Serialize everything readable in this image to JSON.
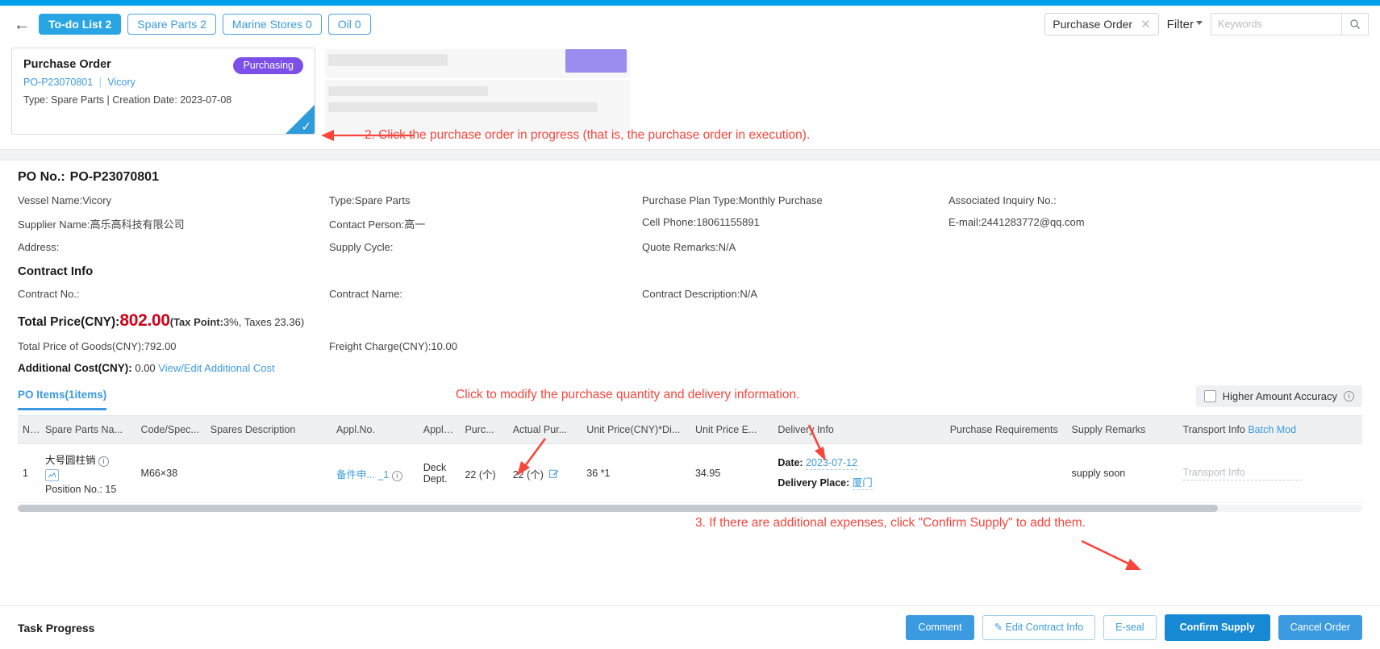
{
  "header": {
    "back_icon": "back-arrow-icon",
    "tabs": [
      {
        "label": "To-do List 2",
        "active": true
      },
      {
        "label": "Spare Parts 2",
        "active": false
      },
      {
        "label": "Marine Stores 0",
        "active": false
      },
      {
        "label": "Oil 0",
        "active": false
      }
    ],
    "type_chip": "Purchase Order",
    "clear_icon": "close-icon",
    "filter_label": "Filter",
    "search_placeholder": "Keywords",
    "search_value": "",
    "search_icon": "search-icon"
  },
  "card": {
    "title": "Purchase Order",
    "status_badge": "Purchasing",
    "po_no": "PO-P23070801",
    "separator": "|",
    "vessel": "Vicory",
    "meta": "Type:  Spare Parts | Creation Date:  2023-07-08",
    "selected_check": "check-icon"
  },
  "annotations": {
    "step2": "2. Click the purchase order in progress (that is, the purchase order in execution).",
    "modify_hint": "Click to modify the purchase quantity and delivery information.",
    "step3": "3. If there are additional expenses, click \"Confirm Supply\" to add them."
  },
  "detail": {
    "po_no_label": "PO No.:",
    "po_no_value": "PO-P23070801",
    "fields": [
      "Vessel Name:Vicory",
      "Type:Spare Parts",
      "Purchase Plan Type:Monthly Purchase",
      "Associated Inquiry No.:",
      "Supplier Name:高乐高科技有限公司",
      "Contact Person:高一",
      "Cell Phone:18061155891",
      "E-mail:2441283772@qq.com",
      "Address:",
      "Supply Cycle:",
      "Quote Remarks:N/A",
      ""
    ],
    "contract_title": "Contract Info",
    "contract_fields": [
      "Contract No.:",
      "Contract Name:",
      "Contract Description:N/A",
      ""
    ],
    "total_label": "Total Price(CNY):",
    "total_value": "802.00",
    "tax_prefix": "(Tax Point:",
    "tax_point": "3%",
    "tax_suffix": ", Taxes 23.36)",
    "total_goods": "Total Price of Goods(CNY):792.00",
    "freight": "Freight Charge(CNY):10.00",
    "addl_label": "Additional Cost(CNY):",
    "addl_value": "0.00",
    "addl_link": "View/Edit Additional Cost"
  },
  "items": {
    "tab_label": "PO Items(1items)",
    "accuracy_label": "Higher Amount Accuracy",
    "accuracy_info_icon": "info-icon",
    "accuracy_checked": false,
    "columns": [
      "N...",
      "Spare Parts Na...",
      "Code/Spec...",
      "Spares Description",
      "Appl.No.",
      "Appl. ...",
      "Purc...",
      "Actual Pur...",
      "Unit Price(CNY)*Di...",
      "Unit Price E...",
      "Delivery Info",
      "Purchase Requirements",
      "Supply Remarks",
      "Transport Info"
    ],
    "transport_batch_link": "Batch Mod",
    "rows": [
      {
        "no": "1",
        "spare_name": "大号圆柱销",
        "name_info_icon": "info-icon",
        "image_icon": "image-icon",
        "position_label": "Position No.:",
        "position_value": "15",
        "code_spec": "M66×38",
        "spares_description": "",
        "appl_no": "备件申... _1",
        "appl_no_info_icon": "info-icon",
        "appl_dept": "Deck Dept.",
        "purc_qty": "22 (个)",
        "actual_purc_qty": "22 (个)",
        "actual_edit_icon": "edit-icon",
        "unit_price_disc": "36 *1",
        "unit_price_excl": "34.95",
        "delivery_date_label": "Date:",
        "delivery_date_value": "2023-07-12",
        "delivery_place_label": "Delivery Place:",
        "delivery_place_value": "厦门",
        "purchase_requirements": "",
        "supply_remarks": "supply soon",
        "transport_placeholder": "Transport Info"
      }
    ]
  },
  "footer": {
    "task_progress": "Task Progress",
    "buttons": [
      {
        "label": "Comment",
        "style": "blue"
      },
      {
        "label": "Edit Contract Info",
        "style": "outline",
        "icon": "edit-icon"
      },
      {
        "label": "E-seal",
        "style": "outline"
      },
      {
        "label": "Confirm Supply",
        "style": "primary"
      },
      {
        "label": "Cancel Order",
        "style": "blue"
      }
    ]
  },
  "colors": {
    "accent": "#3c9ae0",
    "brand_strip": "#00a0e9",
    "badge_purple": "#7b4fe8",
    "total_red": "#d0021b",
    "annotation_red": "#f8453c"
  }
}
